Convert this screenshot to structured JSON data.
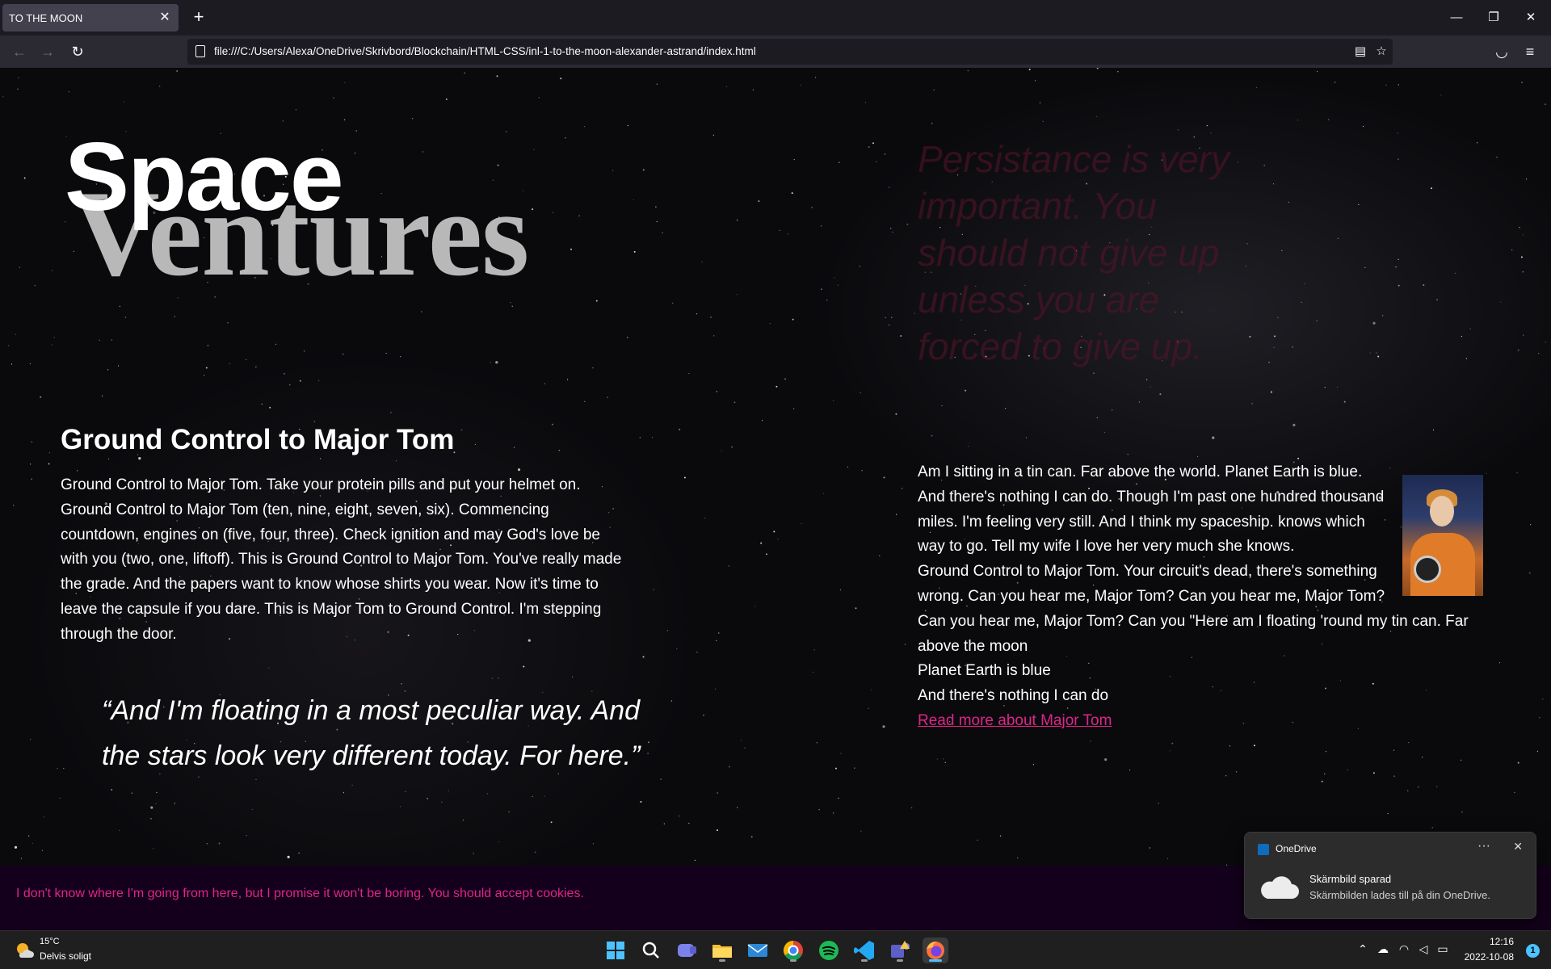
{
  "browser": {
    "tab_title": "TO THE MOON",
    "tab_close": "✕",
    "new_tab": "+",
    "url": "file:///C:/Users/Alexa/OneDrive/Skrivbord/Blockchain/HTML-CSS/inl-1-to-the-moon-alexander-astrand/index.html",
    "window_controls": {
      "minimize": "—",
      "restore": "❐",
      "close": "✕"
    },
    "nav": {
      "back": "←",
      "forward": "→",
      "reload": "↻",
      "menu": "≡"
    }
  },
  "page": {
    "logo_top": "Space",
    "logo_bottom": "Ventures",
    "top_quote": "Persistance is very important. You should not give up unless you are forced to give up.",
    "left_heading": "Ground Control to Major Tom",
    "left_paragraph": "Ground Control to Major Tom. Take your protein pills and put your helmet on. Ground Control to Major Tom (ten, nine, eight, seven, six). Commencing countdown, engines on (five, four, three). Check ignition and may God's love be with you (two, one, liftoff). This is Ground Control to Major Tom. You've really made the grade. And the papers want to know whose shirts you wear. Now it's time to leave the capsule if you dare. This is Major Tom to Ground Control. I'm stepping through the door.",
    "blockquote": "“And I'm floating in a most peculiar way. And the stars look very different today. For here.”",
    "right_lines": [
      "Am I sitting in a tin can. Far above the world. Planet Earth is blue. And there's nothing I can do. Though I'm past one hundred thousand miles. I'm feeling very still. And I think my spaceship. knows which way to go. Tell my wife I love her very much she knows.",
      "Ground Control to Major Tom. Your circuit's dead, there's something wrong. Can you hear me, Major Tom? Can you hear me, Major Tom? Can you hear me, Major Tom? Can you \"Here am I floating 'round my tin can. Far above the moon",
      "Planet Earth is blue",
      "And there's nothing I can do"
    ],
    "read_more": "Read more about Major Tom",
    "cookie_text": "I don't know where I'm going from here, but I promise it won't be boring. You should accept cookies."
  },
  "notification": {
    "app": "OneDrive",
    "more": "···",
    "close": "✕",
    "title": "Skärmbild sparad",
    "body": "Skärmbilden lades till på din OneDrive."
  },
  "taskbar": {
    "weather_temp": "15°C",
    "weather_desc": "Delvis soligt",
    "time": "12:16",
    "date": "2022-10-08",
    "notification_count": "1",
    "apps": [
      "start-icon",
      "search-icon",
      "teams-chat-icon",
      "file-explorer-icon",
      "mail-icon",
      "chrome-icon",
      "spotify-icon",
      "vscode-icon",
      "teams-icon",
      "firefox-icon"
    ]
  },
  "colors": {
    "accent_pink": "#e0248a",
    "cookie_bg": "#14001c",
    "quote_faded": "#5a1428",
    "logo_grey": "#b8b8b8"
  }
}
